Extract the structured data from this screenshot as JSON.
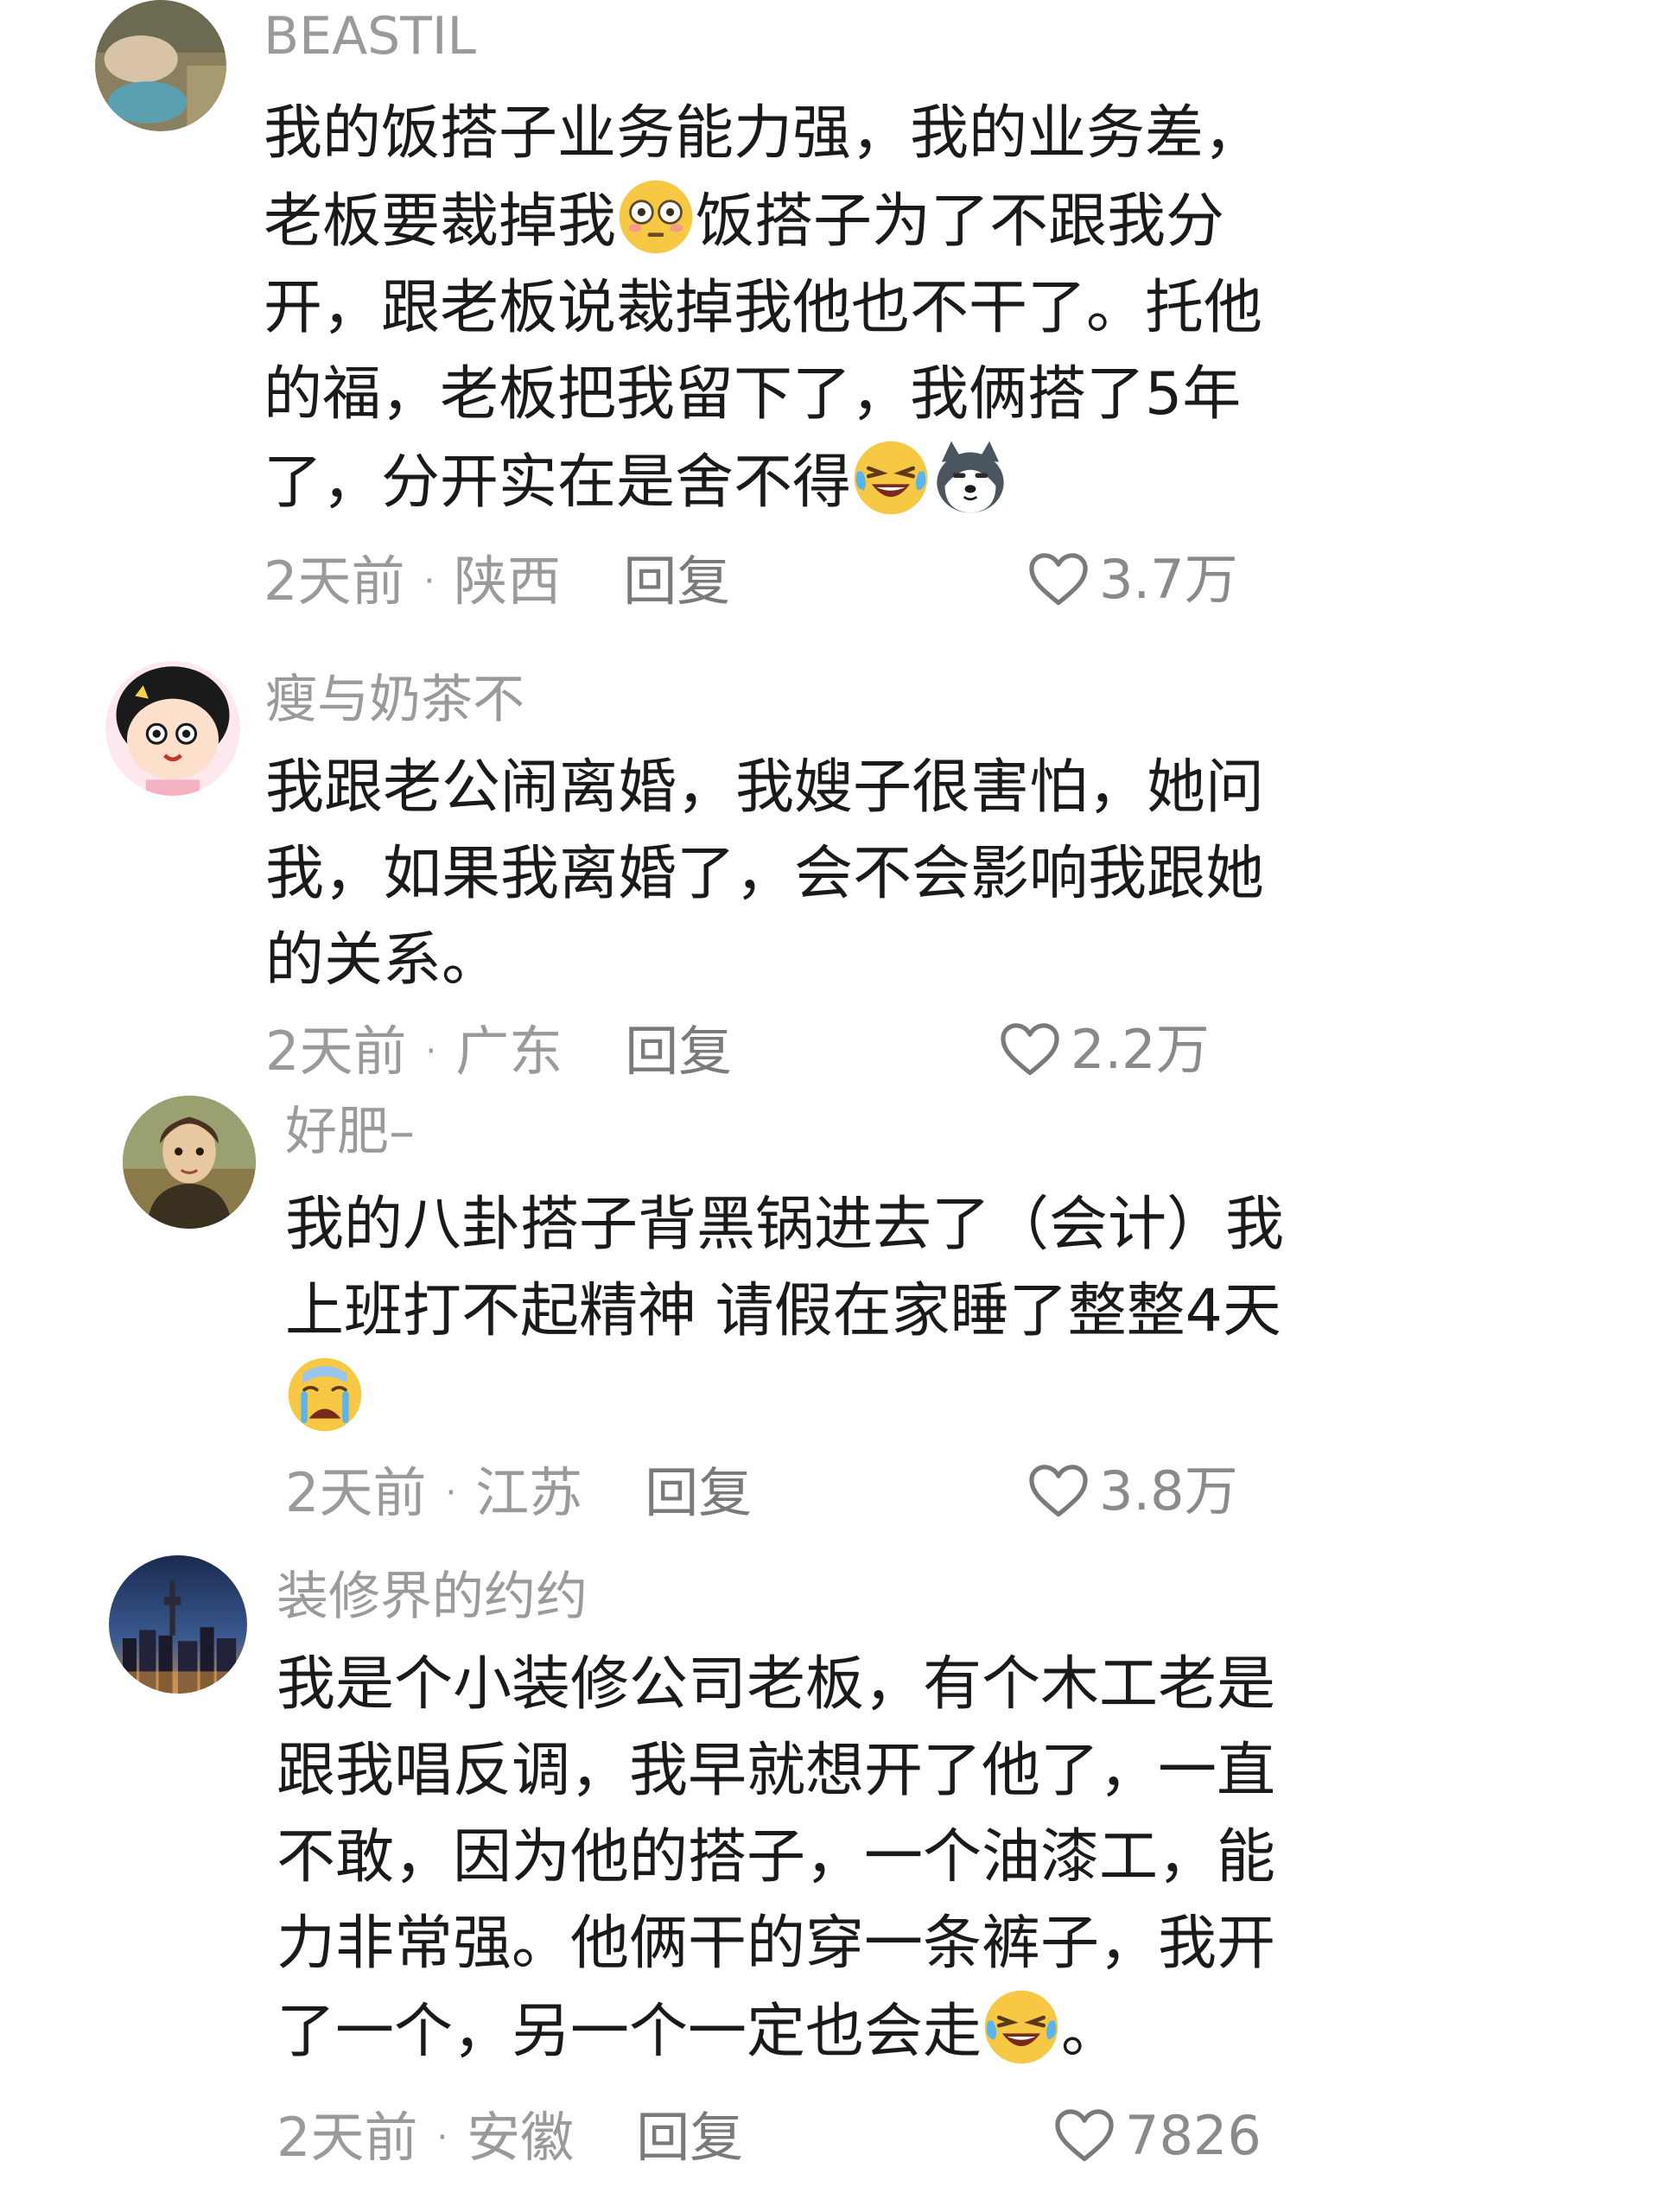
{
  "comments": [
    {
      "username": "BEASTIL",
      "lines": [
        "我的饭搭子业务能力强，我的业务差，",
        "老板要裁掉我",
        "饭搭子为了不跟我分",
        "开，跟老板说裁掉我他也不干了。托他",
        "的福，老板把我留下了，我俩搭了5年",
        "了，分开实在是舍不得"
      ],
      "time": "2天前",
      "location": "陕西",
      "reply": "回复",
      "likes": "3.7万",
      "emojis": [
        "flushed-emoji",
        "laughing-crying-emoji",
        "husky-emoji"
      ]
    },
    {
      "username": "瘦与奶茶不",
      "lines": [
        "我跟老公闹离婚，我嫂子很害怕，她问",
        "我，如果我离婚了，会不会影响我跟她",
        "的关系。"
      ],
      "time": "2天前",
      "location": "广东",
      "reply": "回复",
      "likes": "2.2万"
    },
    {
      "username": "好肥–",
      "lines": [
        "我的八卦搭子背黑锅进去了（会计）我",
        "上班打不起精神 请假在家睡了整整4天"
      ],
      "time": "2天前",
      "location": "江苏",
      "reply": "回复",
      "likes": "3.8万",
      "emojis": [
        "crying-emoji"
      ]
    },
    {
      "username": "装修界的约约",
      "lines": [
        "我是个小装修公司老板，有个木工老是",
        "跟我唱反调，我早就想开了他了，一直",
        "不敢，因为他的搭子，一个油漆工，能",
        "力非常强。他俩干的穿一条裤子，我开",
        "了一个，另一个一定也会走",
        "。"
      ],
      "time": "2天前",
      "location": "安徽",
      "reply": "回复",
      "likes": "7826",
      "emojis": [
        "laughing-crying-emoji"
      ]
    }
  ]
}
